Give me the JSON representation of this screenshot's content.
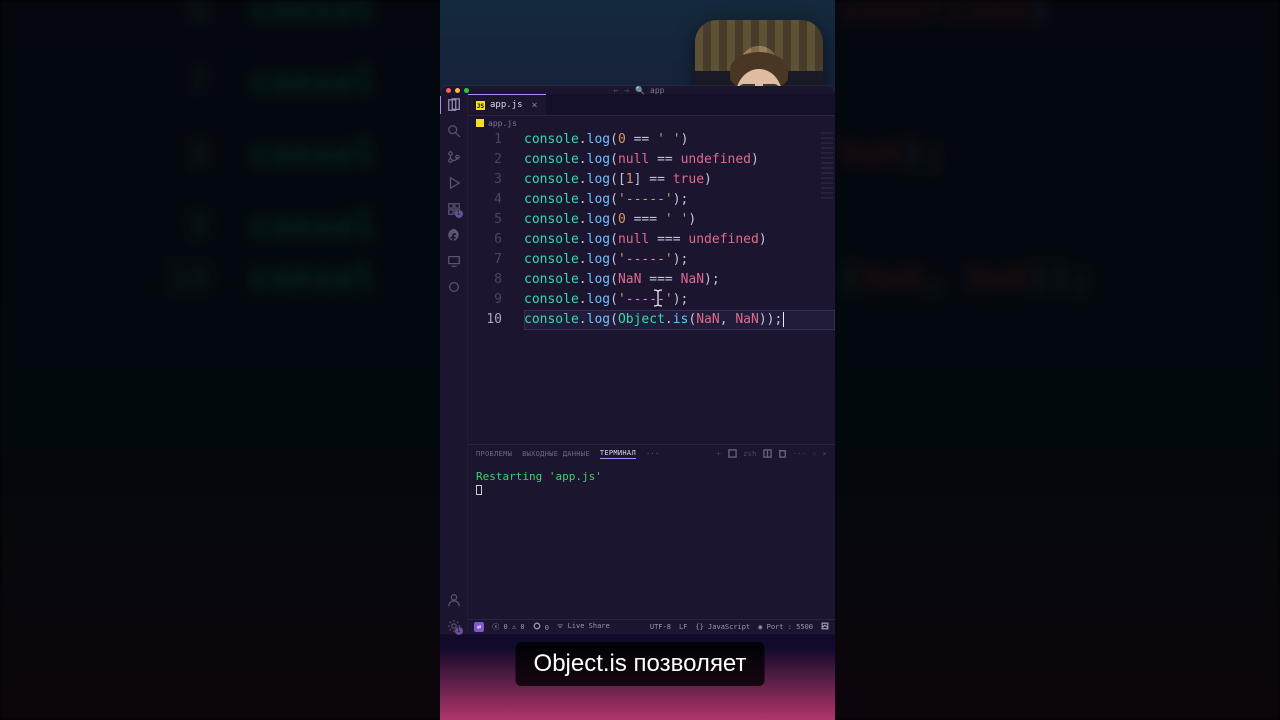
{
  "window": {
    "search_label": "app",
    "search_icon": "🔍"
  },
  "tab": {
    "filename": "app.js",
    "close_glyph": "×"
  },
  "breadcrumb": {
    "file": "app.js"
  },
  "activity_badges": {
    "scm": "1",
    "ext": "1"
  },
  "gutter": {
    "lines": [
      "1",
      "2",
      "3",
      "4",
      "5",
      "6",
      "7",
      "8",
      "9",
      "10"
    ],
    "current": 10
  },
  "code": {
    "l1": {
      "obj": "console",
      "fn": "log",
      "open": "(",
      "a": "0",
      "op": " == ",
      "b": "' '",
      "close": ")"
    },
    "l2": {
      "obj": "console",
      "fn": "log",
      "open": "(",
      "a": "null",
      "op": " == ",
      "b": "undefined",
      "close": ")"
    },
    "l3": {
      "obj": "console",
      "fn": "log",
      "open": "(",
      "lb": "[",
      "a": "1",
      "rb": "]",
      "op": " == ",
      "b": "true",
      "close": ")"
    },
    "l4": {
      "obj": "console",
      "fn": "log",
      "open": "(",
      "s": "'-----'",
      "close": ");"
    },
    "l5": {
      "obj": "console",
      "fn": "log",
      "open": "(",
      "a": "0",
      "op": " === ",
      "b": "' '",
      "close": ")"
    },
    "l6": {
      "obj": "console",
      "fn": "log",
      "open": "(",
      "a": "null",
      "op": " === ",
      "b": "undefined",
      "close": ")"
    },
    "l7": {
      "obj": "console",
      "fn": "log",
      "open": "(",
      "s": "'-----'",
      "close": ");"
    },
    "l8": {
      "obj": "console",
      "fn": "log",
      "open": "(",
      "a": "NaN",
      "op": " === ",
      "b": "NaN",
      "close": ");"
    },
    "l9": {
      "obj": "console",
      "fn": "log",
      "open": "(",
      "s": "'-----'",
      "close": ");"
    },
    "l10": {
      "obj": "console",
      "fn": "log",
      "open": "(",
      "cls": "Object",
      "m": "is",
      "p1": "NaN",
      "comma": ", ",
      "p2": "NaN",
      "close": "));"
    }
  },
  "panel": {
    "tabs": {
      "problems": "ПРОБЛЕМЫ",
      "output": "ВЫХОДНЫЕ ДАННЫЕ",
      "terminal": "ТЕРМИНАЛ",
      "more": "···"
    },
    "shell": "zsh",
    "restart_line": "Restarting 'app.js'"
  },
  "status": {
    "remote_glyph": "⇄",
    "errors": "0",
    "warnings": "0",
    "ports": "0",
    "liveshare": "Live Share",
    "encoding": "UTF-8",
    "eol": "LF",
    "language": "JavaScript",
    "port_label": "Port : 5500"
  },
  "caption": "Object.is позволяет",
  "backdrop_nums": [
    "6",
    "7",
    "8",
    "9",
    "10"
  ],
  "backdrop_word": "consol"
}
